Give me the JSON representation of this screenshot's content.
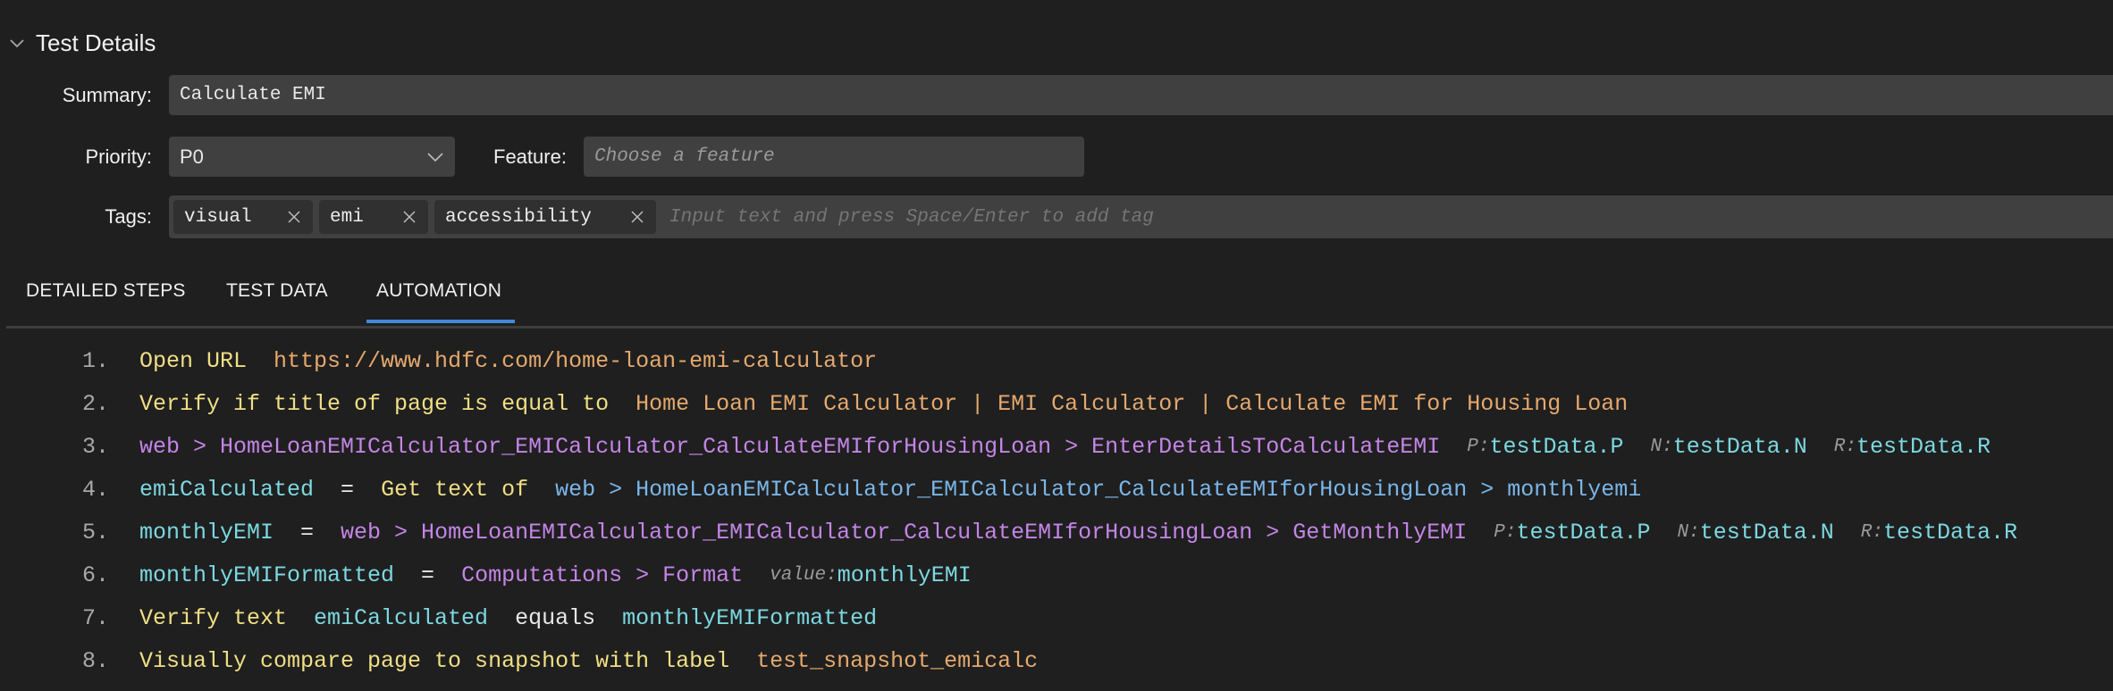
{
  "section": {
    "title": "Test Details",
    "collapsed": false
  },
  "form": {
    "summary_label": "Summary:",
    "summary_value": "Calculate EMI",
    "priority_label": "Priority:",
    "priority_value": "P0",
    "feature_label": "Feature:",
    "feature_placeholder": "Choose a feature",
    "tags_label": "Tags:",
    "tags": [
      {
        "label": "visual"
      },
      {
        "label": "emi"
      },
      {
        "label": "accessibility"
      }
    ],
    "tags_placeholder": "Input text and press Space/Enter to add tag"
  },
  "tabs": [
    {
      "label": "DETAILED STEPS",
      "active": false
    },
    {
      "label": "TEST DATA",
      "active": false
    },
    {
      "label": "AUTOMATION",
      "active": true
    }
  ],
  "colors": {
    "background": "#1f1f1f",
    "input_background": "#404040",
    "chip_background": "#303030",
    "tab_accent": "#3e89d9",
    "keyword": "#f0df84",
    "string": "#e5a86d",
    "element": "#c485e6",
    "element_alt": "#7ab6e8",
    "variable": "#7cd8e0"
  },
  "steps": [
    {
      "num": "1.",
      "keyword": "Open URL",
      "url": "https://www.hdfc.com/home-loan-emi-calculator"
    },
    {
      "num": "2.",
      "keyword": "Verify if title of page is equal to",
      "value": "Home Loan EMI Calculator | EMI Calculator | Calculate EMI for Housing Loan"
    },
    {
      "num": "3.",
      "element": "web > HomeLoanEMICalculator_EMICalculator_CalculateEMIforHousingLoan > EnterDetailsToCalculateEMI",
      "params": [
        {
          "name": "P:",
          "value": "testData.P"
        },
        {
          "name": "N:",
          "value": "testData.N"
        },
        {
          "name": "R:",
          "value": "testData.R"
        }
      ]
    },
    {
      "num": "4.",
      "variable": "emiCalculated",
      "op": "=",
      "keyword": "Get text of",
      "element": "web > HomeLoanEMICalculator_EMICalculator_CalculateEMIforHousingLoan > monthlyemi"
    },
    {
      "num": "5.",
      "variable": "monthlyEMI",
      "op": "=",
      "element": "web > HomeLoanEMICalculator_EMICalculator_CalculateEMIforHousingLoan > GetMonthlyEMI",
      "params": [
        {
          "name": "P:",
          "value": "testData.P"
        },
        {
          "name": "N:",
          "value": "testData.N"
        },
        {
          "name": "R:",
          "value": "testData.R"
        }
      ]
    },
    {
      "num": "6.",
      "variable": "monthlyEMIFormatted",
      "op": "=",
      "element": "Computations > Format",
      "params": [
        {
          "name": "value:",
          "value": "monthlyEMI"
        }
      ]
    },
    {
      "num": "7.",
      "keyword": "Verify text",
      "left": "emiCalculated",
      "op": "equals",
      "right": "monthlyEMIFormatted"
    },
    {
      "num": "8.",
      "keyword": "Visually compare page to snapshot with label",
      "value": "test_snapshot_emicalc"
    }
  ]
}
